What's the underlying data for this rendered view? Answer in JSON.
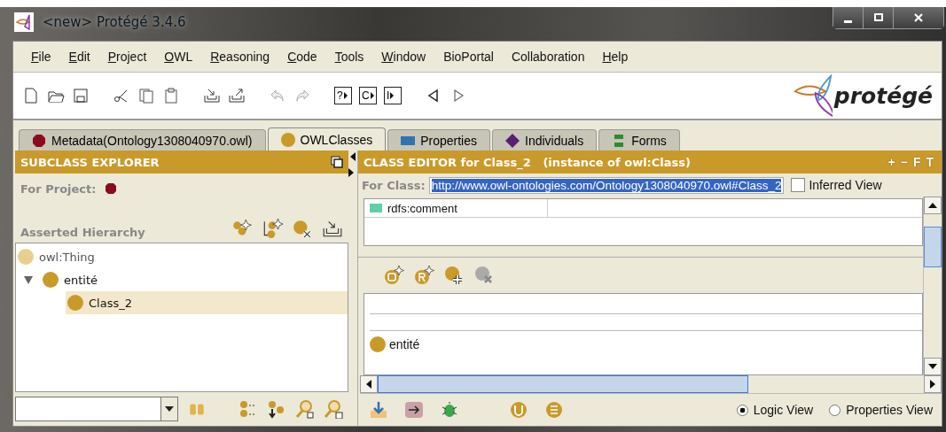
{
  "window": {
    "title": "<new>  Protégé 3.4.6"
  },
  "menu": [
    {
      "label": "File",
      "underlined": true
    },
    {
      "label": "Edit",
      "underlined": true
    },
    {
      "label": "Project",
      "underlined": true
    },
    {
      "label": "OWL",
      "underlined": true
    },
    {
      "label": "Reasoning",
      "underlined": true
    },
    {
      "label": "Code",
      "underlined": true
    },
    {
      "label": "Tools",
      "underlined": true
    },
    {
      "label": "Window",
      "underlined": true
    },
    {
      "label": "BioPortal",
      "underlined": false
    },
    {
      "label": "Collaboration",
      "underlined": false
    },
    {
      "label": "Help",
      "underlined": true
    }
  ],
  "toolbar": {
    "letter_buttons": [
      "?",
      "C",
      "I"
    ]
  },
  "logo": {
    "text": "protégé"
  },
  "tabs": [
    {
      "label": "Metadata(Ontology1308040970.owl)",
      "kind": "metadata",
      "selected": false
    },
    {
      "label": "OWLClasses",
      "kind": "classes",
      "selected": true
    },
    {
      "label": "Properties",
      "kind": "properties",
      "selected": false
    },
    {
      "label": "Individuals",
      "kind": "individuals",
      "selected": false
    },
    {
      "label": "Forms",
      "kind": "forms",
      "selected": false
    }
  ],
  "subclass_explorer": {
    "title": "SUBCLASS EXPLORER",
    "for_project_label": "For Project:",
    "hierarchy_label": "Asserted Hierarchy",
    "tree": [
      {
        "label": "owl:Thing",
        "kind": "root",
        "selected": false,
        "children": [
          {
            "label": "entité",
            "kind": "class",
            "expanded": true,
            "selected": false,
            "children": [
              {
                "label": "Class_2",
                "kind": "class",
                "selected": true
              }
            ]
          }
        ]
      }
    ]
  },
  "class_editor": {
    "title": "CLASS EDITOR for Class_2   (instance of owl:Class)",
    "header_buttons": [
      "+",
      "−",
      "F",
      "T"
    ],
    "for_class_label": "For Class:",
    "for_class_value": "http://www.owl-ontologies.com/Ontology1308040970.owl#Class_2",
    "inferred_view": {
      "label": "Inferred View",
      "checked": false
    },
    "annotation_rows": [
      "rdfs:comment"
    ],
    "superclasses": [
      "entité"
    ],
    "views": [
      {
        "label": "Logic View",
        "selected": true
      },
      {
        "label": "Properties View",
        "selected": false
      }
    ]
  }
}
